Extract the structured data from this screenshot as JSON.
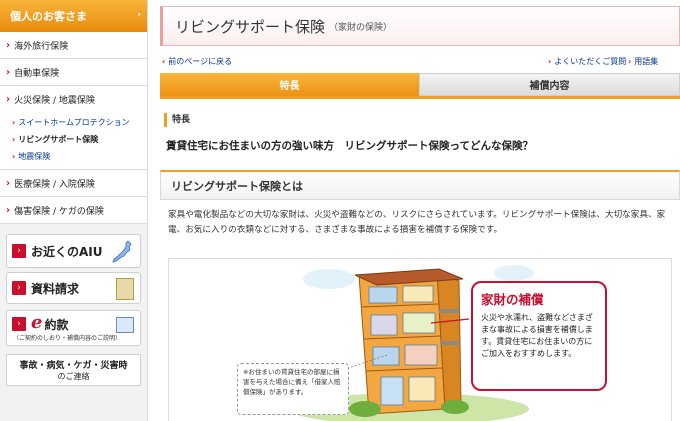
{
  "sidebar": {
    "header": "個人のお客さま",
    "items": [
      {
        "label": "海外旅行保険"
      },
      {
        "label": "自動車保険"
      },
      {
        "label": "火災保険 / 地震保険"
      }
    ],
    "sub_items": [
      {
        "label": "スイートホームプロテクション"
      },
      {
        "label": "リビングサポート保険"
      },
      {
        "label": "地震保険"
      }
    ],
    "items2": [
      {
        "label": "医療保険 / 入院保険"
      },
      {
        "label": "傷害保険 / ケガの保険"
      }
    ],
    "box_nearby": "お近くのAIU",
    "box_request": "資料請求",
    "box_e_letter": "e",
    "box_e_label": "約款",
    "box_e_note": "（ご契約のしおり・補償内容のご説明）",
    "box_accident_line1": "事故・病気・ケガ・災害時",
    "box_accident_line2": "のご連絡"
  },
  "title": "リビングサポート保険",
  "title_sub": "（家財の保険）",
  "nav": {
    "back": "前のページに戻る",
    "faq": "よくいただくご質問",
    "glossary": "用語集"
  },
  "tabs": [
    {
      "label": "特長"
    },
    {
      "label": "補償内容"
    }
  ],
  "feature_label": "特長",
  "feature_heading": "賃貸住宅にお住まいの方の強い味方　リビングサポート保険ってどんな保険？",
  "section_title": "リビングサポート保険とは",
  "description": "家具や電化製品などの大切な家財は、火災や盗難などの、リスクにさらされています。リビングサポート保険は、大切な家具、家電、お気に入りの衣類などに対する、さまざまな事故による損害を補償する保険です。",
  "callout": {
    "title": "家財の補償",
    "body": "火災や水濡れ、盗難などさまざまな事故による損害を補償します。賃貸住宅にお住まいの方にご加入をおすすめします。"
  },
  "note": "※お住まいの賃貸住宅の部屋に損害を与えた場合に備え「借家人賠償保険」があります。",
  "colors": {
    "orange": "#f0a01e",
    "red": "#c8102e",
    "link": "#003399"
  }
}
